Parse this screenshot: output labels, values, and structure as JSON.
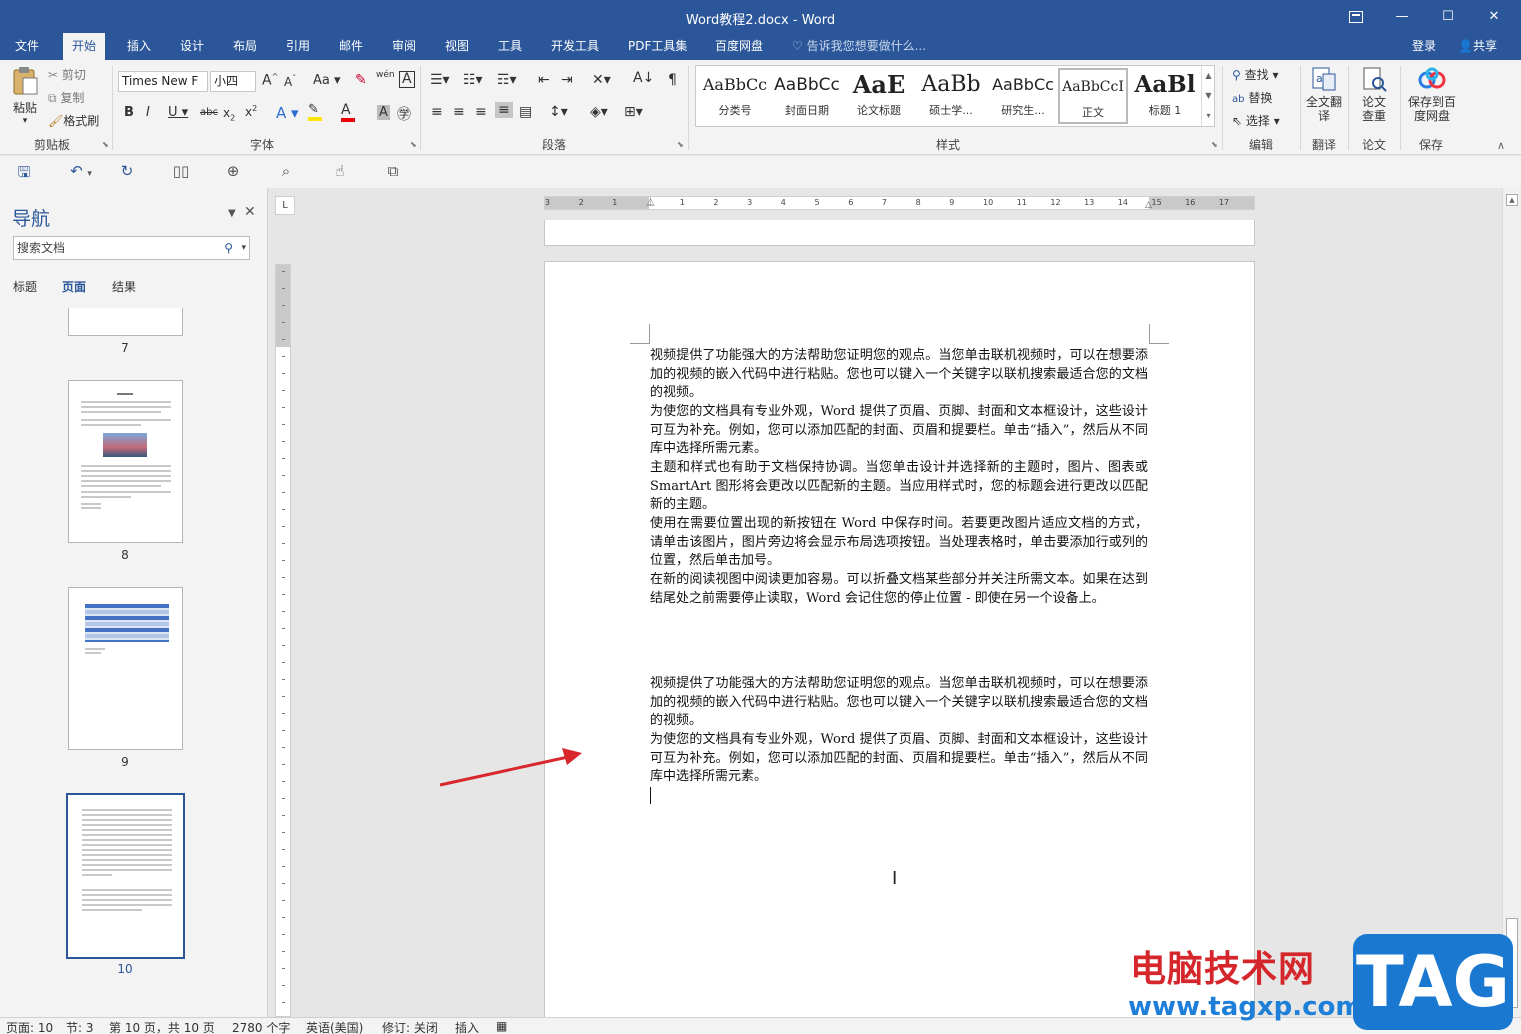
{
  "titlebar": {
    "title": "Word教程2.docx - Word",
    "restore_icon": "ribbon-display-icon",
    "minimize": "—",
    "maximize": "☐",
    "close": "✕"
  },
  "tabs": [
    "文件",
    "开始",
    "插入",
    "设计",
    "布局",
    "引用",
    "邮件",
    "审阅",
    "视图",
    "工具",
    "开发工具",
    "PDF工具集",
    "百度网盘"
  ],
  "active_tab": "开始",
  "tell_me": "告诉我您想要做什么...",
  "login": "登录",
  "share": "共享",
  "ribbon": {
    "clipboard": {
      "paste": "粘贴",
      "cut": "剪切",
      "copy": "复制",
      "format_painter": "格式刷",
      "label": "剪贴板"
    },
    "font": {
      "font_name": "Times New F",
      "font_size": "小四",
      "change_case": "Aa",
      "label": "字体",
      "wen": "wén"
    },
    "paragraph": {
      "label": "段落"
    },
    "styles": {
      "label": "样式",
      "items": [
        {
          "preview": "AaBbCc",
          "name": "分类号"
        },
        {
          "preview": "AaBbCc",
          "name": "封面日期"
        },
        {
          "preview": "AaE",
          "name": "论文标题"
        },
        {
          "preview": "AaBb",
          "name": "硕士学..."
        },
        {
          "preview": "AaBbCc",
          "name": "研究生..."
        },
        {
          "preview": "AaBbCcI",
          "name": "正文"
        },
        {
          "preview": "AaBl",
          "name": "标题 1"
        }
      ]
    },
    "editing": {
      "find": "查找",
      "replace": "替换",
      "select": "选择",
      "label": "编辑"
    },
    "translate": {
      "full": "全文翻译",
      "label": "翻译"
    },
    "paper": {
      "check": "论文查重",
      "label": "论文"
    },
    "save": {
      "baidu": "保存到百度网盘",
      "label": "保存"
    }
  },
  "nav": {
    "title": "导航",
    "search_placeholder": "搜索文档",
    "tabs": [
      "标题",
      "页面",
      "结果"
    ],
    "active_tab": "页面",
    "pages": [
      "7",
      "8",
      "9",
      "10"
    ],
    "selected_page": "10"
  },
  "ruler_numbers": [
    "3",
    "2",
    "1",
    "1",
    "2",
    "3",
    "4",
    "5",
    "6",
    "7",
    "8",
    "9",
    "10",
    "11",
    "12",
    "13",
    "14",
    "15",
    "16",
    "17"
  ],
  "document": {
    "paragraphs_block1": [
      "视频提供了功能强大的方法帮助您证明您的观点。当您单击联机视频时，可以在想要添加的视频的嵌入代码中进行粘贴。您也可以键入一个关键字以联机搜索最适合您的文档的视频。",
      "为使您的文档具有专业外观，Word 提供了页眉、页脚、封面和文本框设计，这些设计可互为补充。例如，您可以添加匹配的封面、页眉和提要栏。单击“插入”，然后从不同库中选择所需元素。",
      "主题和样式也有助于文档保持协调。当您单击设计并选择新的主题时，图片、图表或 SmartArt 图形将会更改以匹配新的主题。当应用样式时，您的标题会进行更改以匹配新的主题。",
      "使用在需要位置出现的新按钮在 Word 中保存时间。若要更改图片适应文档的方式，请单击该图片，图片旁边将会显示布局选项按钮。当处理表格时，单击要添加行或列的位置，然后单击加号。",
      "在新的阅读视图中阅读更加容易。可以折叠文档某些部分并关注所需文本。如果在达到结尾处之前需要停止读取，Word 会记住您的停止位置 - 即使在另一个设备上。"
    ],
    "paragraphs_block2": [
      "视频提供了功能强大的方法帮助您证明您的观点。当您单击联机视频时，可以在想要添加的视频的嵌入代码中进行粘贴。您也可以键入一个关键字以联机搜索最适合您的文档的视频。",
      "为使您的文档具有专业外观，Word 提供了页眉、页脚、封面和文本框设计，这些设计可互为补充。例如，您可以添加匹配的封面、页眉和提要栏。单击“插入”，然后从不同库中选择所需元素。"
    ]
  },
  "status": {
    "page": "页面: 10",
    "section": "节: 3",
    "page_of": "第 10 页，共 10 页",
    "words": "2780 个字",
    "language": "英语(美国)",
    "track": "修订: 关闭",
    "insert": "插入"
  },
  "watermark": {
    "cn": "电脑技术网",
    "url": "www.tagxp.com",
    "tag": "TAG"
  },
  "colors": {
    "brand": "#2b579a",
    "arrow": "#d9272e"
  }
}
